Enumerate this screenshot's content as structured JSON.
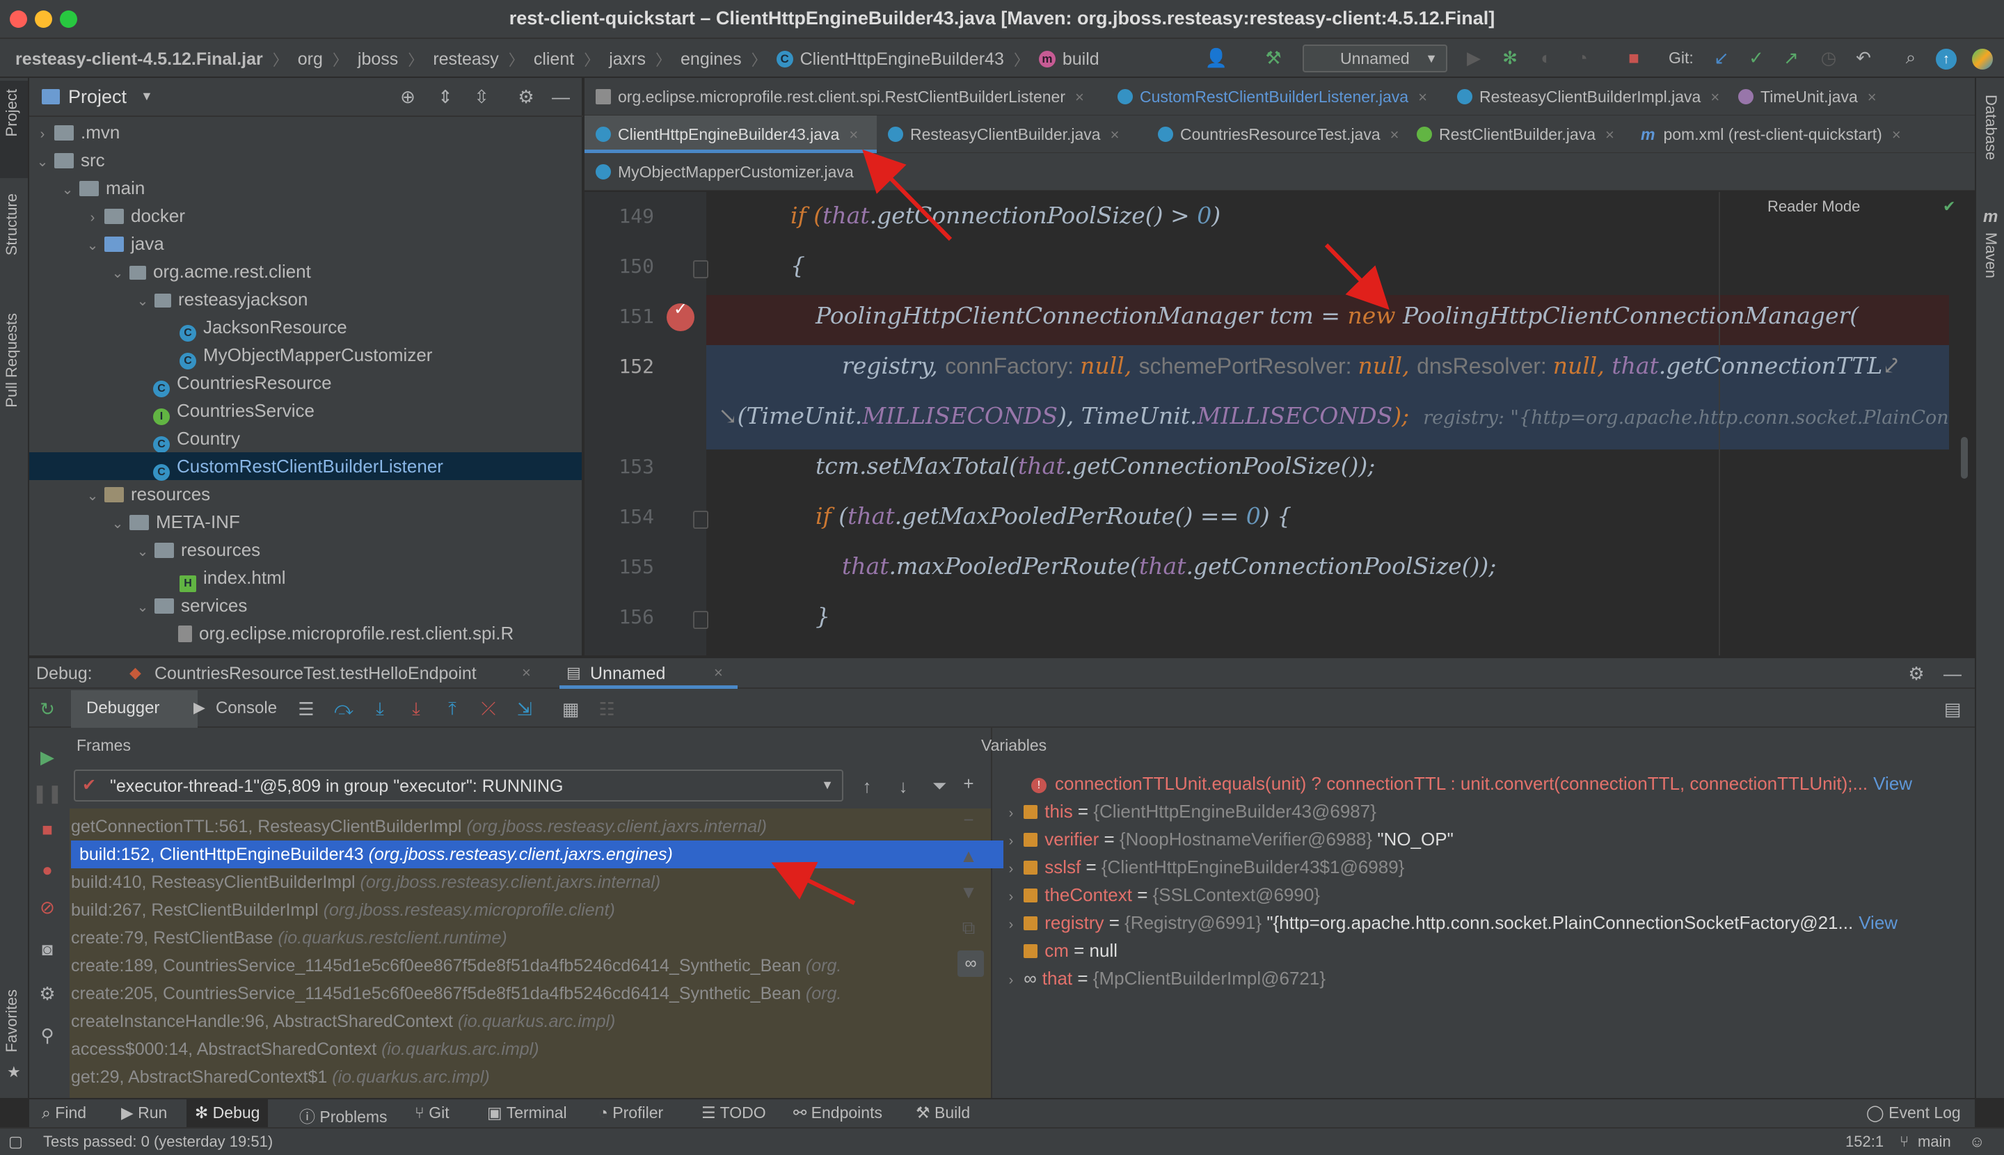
{
  "window": {
    "title": "rest-client-quickstart – ClientHttpEngineBuilder43.java [Maven: org.jboss.resteasy:resteasy-client:4.5.12.Final]"
  },
  "breadcrumb": [
    "resteasy-client-4.5.12.Final.jar",
    "org",
    "jboss",
    "resteasy",
    "client",
    "jaxrs",
    "engines",
    "ClientHttpEngineBuilder43",
    "build"
  ],
  "toolbar": {
    "run_config": "Unnamed",
    "git_label": "Git:"
  },
  "left_strip": {
    "project": "Project",
    "structure": "Structure",
    "pull_requests": "Pull Requests",
    "favorites": "Favorites"
  },
  "right_strip": {
    "database": "Database",
    "maven": "Maven"
  },
  "project": {
    "title": "Project",
    "tree": [
      {
        "label": ".mvn",
        "kind": "folder"
      },
      {
        "label": "src",
        "kind": "folder"
      },
      {
        "label": "main",
        "kind": "folder"
      },
      {
        "label": "docker",
        "kind": "folder"
      },
      {
        "label": "java",
        "kind": "folder-blue"
      },
      {
        "label": "org.acme.rest.client",
        "kind": "package"
      },
      {
        "label": "resteasyjackson",
        "kind": "package"
      },
      {
        "label": "JacksonResource",
        "kind": "class"
      },
      {
        "label": "MyObjectMapperCustomizer",
        "kind": "class"
      },
      {
        "label": "CountriesResource",
        "kind": "class"
      },
      {
        "label": "CountriesService",
        "kind": "interface"
      },
      {
        "label": "Country",
        "kind": "class"
      },
      {
        "label": "CustomRestClientBuilderListener",
        "kind": "class"
      },
      {
        "label": "resources",
        "kind": "folder-res"
      },
      {
        "label": "META-INF",
        "kind": "folder"
      },
      {
        "label": "resources",
        "kind": "folder"
      },
      {
        "label": "index.html",
        "kind": "html"
      },
      {
        "label": "services",
        "kind": "folder"
      },
      {
        "label": "org.eclipse.microprofile.rest.client.spi.R",
        "kind": "file"
      }
    ]
  },
  "editor_tabs": {
    "row1": [
      "org.eclipse.microprofile.rest.client.spi.RestClientBuilderListener",
      "CustomRestClientBuilderListener.java",
      "ResteasyClientBuilderImpl.java",
      "TimeUnit.java"
    ],
    "row2": [
      "ClientHttpEngineBuilder43.java",
      "ResteasyClientBuilder.java",
      "CountriesResourceTest.java",
      "RestClientBuilder.java",
      "pom.xml (rest-client-quickstart)"
    ],
    "row3": [
      "MyObjectMapperCustomizer.java"
    ]
  },
  "reader_mode": "Reader Mode",
  "code": {
    "line_numbers": [
      "149",
      "150",
      "151",
      "152",
      "153",
      "154",
      "155",
      "156"
    ],
    "l149_a": "if (",
    "l149_b": "that",
    "l149_c": ".getConnectionPoolSize() > ",
    "l149_d": "0",
    "l149_e": ")",
    "l150": "{",
    "l151_a": "PoolingHttpClientConnectionManager tcm = ",
    "l151_b": "new",
    "l151_c": " PoolingHttpClientConnectionManager(",
    "l152a_a": "registry, ",
    "l152a_h1": "connFactory: ",
    "l152a_n1": "null",
    "l152a_s1": ", ",
    "l152a_h2": "schemePortResolver: ",
    "l152a_n2": "null",
    "l152a_s2": ", ",
    "l152a_h3": "dnsResolver: ",
    "l152a_n3": "null",
    "l152a_s3": ", ",
    "l152a_t": "that",
    "l152a_e": ".getConnectionTTL",
    "l152b_a": "(TimeUnit.",
    "l152b_b": "MILLISECONDS",
    "l152b_c": "), TimeUnit.",
    "l152b_d": "MILLISECONDS",
    "l152b_e": ");",
    "l152b_hint": "registry: \"{http=org.apache.http.conn.socket.PlainConnectionSocket",
    "l153_a": "tcm.setMaxTotal(",
    "l153_b": "that",
    "l153_c": ".getConnectionPoolSize());",
    "l154_a": "if",
    "l154_b": " (",
    "l154_c": "that",
    "l154_d": ".getMaxPooledPerRoute() == ",
    "l154_e": "0",
    "l154_f": ") {",
    "l155_a": "that",
    "l155_b": ".maxPooledPerRoute(",
    "l155_c": "that",
    "l155_d": ".getConnectionPoolSize());",
    "l156": "}"
  },
  "debug": {
    "label": "Debug:",
    "tab1": "CountriesResourceTest.testHelloEndpoint",
    "tab2": "Unnamed",
    "debugger_tab": "Debugger",
    "console_tab": "Console",
    "frames_header": "Frames",
    "variables_header": "Variables",
    "thread": "\"executor-thread-1\"@5,809 in group \"executor\": RUNNING",
    "frames": [
      {
        "method": "getConnectionTTL:561, ResteasyClientBuilderImpl ",
        "pkg": "(org.jboss.resteasy.client.jaxrs.internal)"
      },
      {
        "method": "build:152, ClientHttpEngineBuilder43 ",
        "pkg": "(org.jboss.resteasy.client.jaxrs.engines)"
      },
      {
        "method": "build:410, ResteasyClientBuilderImpl ",
        "pkg": "(org.jboss.resteasy.client.jaxrs.internal)"
      },
      {
        "method": "build:267, RestClientBuilderImpl ",
        "pkg": "(org.jboss.resteasy.microprofile.client)"
      },
      {
        "method": "create:79, RestClientBase ",
        "pkg": "(io.quarkus.restclient.runtime)"
      },
      {
        "method": "create:189, CountriesService_1145d1e5c6f0ee867f5de8f51da4fb5246cd6414_Synthetic_Bean ",
        "pkg": "(org."
      },
      {
        "method": "create:205, CountriesService_1145d1e5c6f0ee867f5de8f51da4fb5246cd6414_Synthetic_Bean ",
        "pkg": "(org."
      },
      {
        "method": "createInstanceHandle:96, AbstractSharedContext ",
        "pkg": "(io.quarkus.arc.impl)"
      },
      {
        "method": "access$000:14, AbstractSharedContext ",
        "pkg": "(io.quarkus.arc.impl)"
      },
      {
        "method": "get:29, AbstractSharedContext$1 ",
        "pkg": "(io.quarkus.arc.impl)"
      }
    ],
    "variables": {
      "error": "connectionTTLUnit.equals(unit) ? connectionTTL : unit.convert(connectionTTL, connectionTTLUnit);...",
      "error_view": "View",
      "this_name": "this",
      "this_val": "{ClientHttpEngineBuilder43@6987}",
      "verifier_name": "verifier",
      "verifier_val": "{NoopHostnameVerifier@6988}",
      "verifier_str": "\"NO_OP\"",
      "sslsf_name": "sslsf",
      "sslsf_val": "{ClientHttpEngineBuilder43$1@6989}",
      "ctx_name": "theContext",
      "ctx_val": "{SSLContext@6990}",
      "registry_name": "registry",
      "registry_val": "{Registry@6991}",
      "registry_str": "\"{http=org.apache.http.conn.socket.PlainConnectionSocketFactory@21...",
      "registry_view": "View",
      "cm_name": "cm",
      "cm_val": "null",
      "that_name": "that",
      "that_val": "{MpClientBuilderImpl@6721}",
      "eq": " = "
    }
  },
  "bottom_tools": [
    "Find",
    "Run",
    "Debug",
    "Problems",
    "Git",
    "Terminal",
    "Profiler",
    "TODO",
    "Endpoints",
    "Build"
  ],
  "event_log": "Event Log",
  "status": {
    "message": "Tests passed: 0 (yesterday 19:51)",
    "position": "152:1",
    "branch": "main"
  },
  "colors": {
    "accent": "#4a88c7",
    "selected_frame": "#2f65ca",
    "error": "#e3716b",
    "keyword": "#cc7832",
    "field": "#9876aa",
    "annotation_arrow": "#e0201b"
  }
}
